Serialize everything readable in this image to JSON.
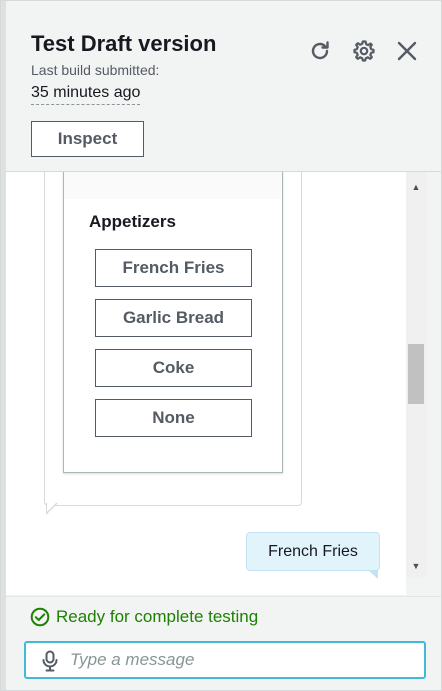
{
  "header": {
    "title": "Test Draft version",
    "build_label": "Last build submitted:",
    "build_time": "35 minutes ago",
    "inspect_label": "Inspect",
    "icons": [
      "refresh-icon",
      "gear-icon",
      "close-icon"
    ]
  },
  "chat": {
    "card": {
      "title": "Appetizers",
      "options": [
        {
          "label": "French Fries"
        },
        {
          "label": "Garlic Bread"
        },
        {
          "label": "Coke"
        },
        {
          "label": "None"
        }
      ]
    },
    "user_message": "French Fries"
  },
  "footer": {
    "status_text": "Ready for complete testing",
    "input_placeholder": "Type a message",
    "input_value": ""
  },
  "colors": {
    "status_green": "#1d8102",
    "input_focus": "#44b9d6",
    "user_bubble": "#e1f3fb"
  }
}
